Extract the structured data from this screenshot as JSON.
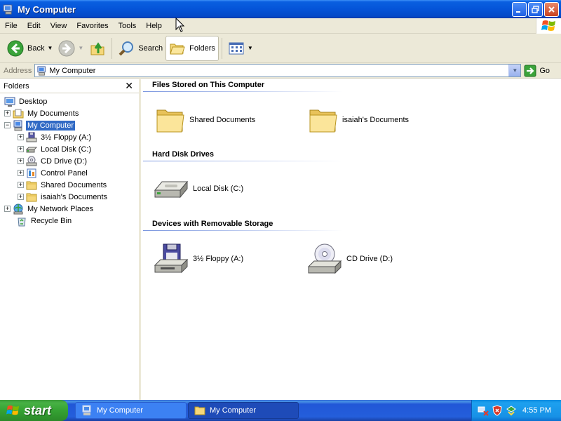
{
  "window": {
    "title": "My Computer"
  },
  "menu": {
    "items": [
      "File",
      "Edit",
      "View",
      "Favorites",
      "Tools",
      "Help"
    ]
  },
  "toolbar": {
    "back_label": "Back",
    "search_label": "Search",
    "folders_label": "Folders"
  },
  "address": {
    "label": "Address",
    "value": "My Computer",
    "go_label": "Go"
  },
  "folders_pane": {
    "title": "Folders",
    "tree": [
      {
        "label": "Desktop",
        "indent": 0,
        "expander": "",
        "icon": "desktop-icon"
      },
      {
        "label": "My Documents",
        "indent": 1,
        "expander": "+",
        "icon": "my-documents-icon"
      },
      {
        "label": "My Computer",
        "indent": 1,
        "expander": "−",
        "icon": "my-computer-icon",
        "selected": true
      },
      {
        "label": "3½ Floppy (A:)",
        "indent": 2,
        "expander": "+",
        "icon": "floppy-drive-icon"
      },
      {
        "label": "Local Disk (C:)",
        "indent": 2,
        "expander": "+",
        "icon": "hard-disk-icon"
      },
      {
        "label": "CD Drive (D:)",
        "indent": 2,
        "expander": "+",
        "icon": "cd-drive-icon"
      },
      {
        "label": "Control Panel",
        "indent": 2,
        "expander": "+",
        "icon": "control-panel-icon"
      },
      {
        "label": "Shared Documents",
        "indent": 2,
        "expander": "+",
        "icon": "folder-icon"
      },
      {
        "label": "isaiah's Documents",
        "indent": 2,
        "expander": "+",
        "icon": "folder-icon"
      },
      {
        "label": "My Network Places",
        "indent": 1,
        "expander": "+",
        "icon": "network-places-icon"
      },
      {
        "label": "Recycle Bin",
        "indent": 1,
        "expander": "",
        "icon": "recycle-bin-icon"
      }
    ]
  },
  "content": {
    "groups": [
      {
        "title": "Files Stored on This Computer",
        "items": [
          {
            "label": "Shared Documents",
            "icon": "folder-icon"
          },
          {
            "label": "isaiah's Documents",
            "icon": "folder-icon"
          }
        ]
      },
      {
        "title": "Hard Disk Drives",
        "items": [
          {
            "label": "Local Disk (C:)",
            "icon": "hard-disk-icon"
          }
        ]
      },
      {
        "title": "Devices with Removable Storage",
        "items": [
          {
            "label": "3½ Floppy (A:)",
            "icon": "floppy-drive-icon"
          },
          {
            "label": "CD Drive (D:)",
            "icon": "cd-drive-icon"
          }
        ]
      }
    ]
  },
  "taskbar": {
    "start_label": "start",
    "tasks": [
      {
        "label": "My Computer",
        "active": false
      },
      {
        "label": "My Computer",
        "active": true
      }
    ],
    "clock": "4:55 PM"
  },
  "colors": {
    "title_bar": "#0554d8",
    "selection": "#316ac5",
    "chrome": "#ece9d8",
    "start_green": "#35a233",
    "taskbar_blue": "#245edb"
  }
}
